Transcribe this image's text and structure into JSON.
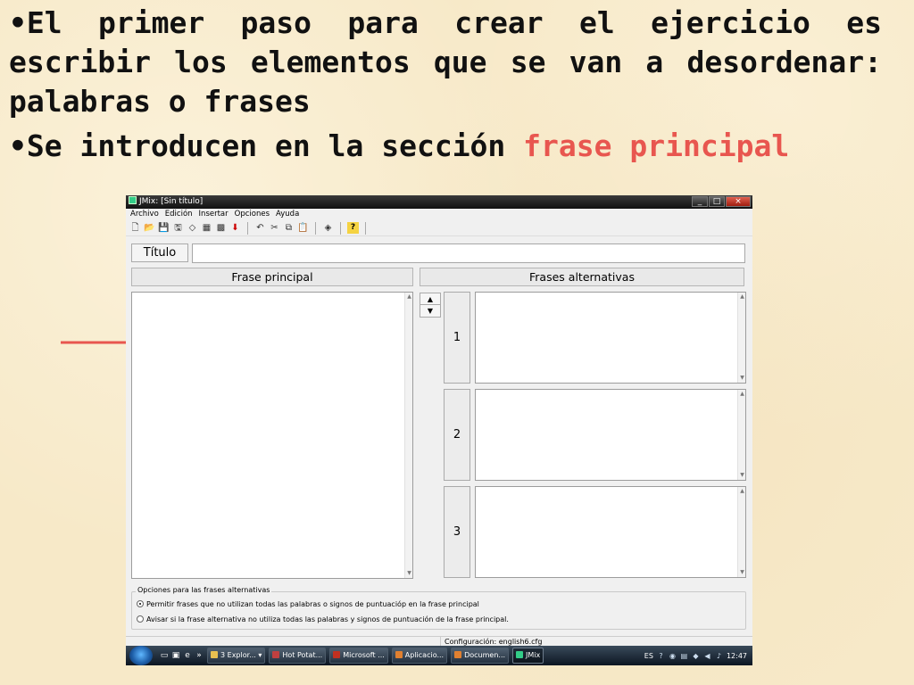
{
  "slide": {
    "bullet1": "•El primer paso para crear el ejercicio es escribir los elementos que se van a desordenar: palabras o frases",
    "bullet2_prefix": "•Se introducen en la sección ",
    "bullet2_highlight": "frase principal",
    "accent_color": "#e8564f"
  },
  "window": {
    "title": "JMix: [Sin título]",
    "controls": {
      "minimize": "_",
      "maximize": "□",
      "close": "×"
    }
  },
  "menu": [
    "Archivo",
    "Edición",
    "Insertar",
    "Opciones",
    "Ayuda"
  ],
  "toolbar": {
    "icons": [
      "new-icon",
      "open-icon",
      "save-icon",
      "save-as-icon",
      "export-icon",
      "web-icon",
      "web-options-icon",
      "down-arrow-icon",
      "undo-icon",
      "cut-icon",
      "copy-icon",
      "paste-icon",
      "hotpot-icon",
      "help-icon"
    ],
    "help_label": "?"
  },
  "form": {
    "title_button": "Título",
    "title_value": "",
    "main_header": "Frase principal",
    "main_value": "",
    "alt_header": "Frases alternativas",
    "alt_numbers": [
      "1",
      "2",
      "3"
    ],
    "alt_values": [
      "",
      "",
      ""
    ]
  },
  "options": {
    "legend": "Opciones para las frases alternativas",
    "option1": "Permitir frases que no utilizan todas las palabras o signos de puntuacióp en la frase principal",
    "option2": "Avisar si la frase alternativa no utiliza todas las palabras y signos de puntuación de la frase principal.",
    "selected": 1
  },
  "status": {
    "config": "Configuración: english6.cfg"
  },
  "taskbar": {
    "overflow": "»",
    "buttons": [
      {
        "label": "3 Explor...",
        "color": "#e8c050",
        "menu": "▾"
      },
      {
        "label": "Hot Potat...",
        "color": "#c04040"
      },
      {
        "label": "Microsoft ...",
        "color": "#c03020"
      },
      {
        "label": "Aplicacio...",
        "color": "#e08030"
      },
      {
        "label": "Documen...",
        "color": "#e08030"
      },
      {
        "label": "JMix",
        "color": "#3c8",
        "active": true
      }
    ],
    "language": "ES",
    "time": "12:47"
  }
}
